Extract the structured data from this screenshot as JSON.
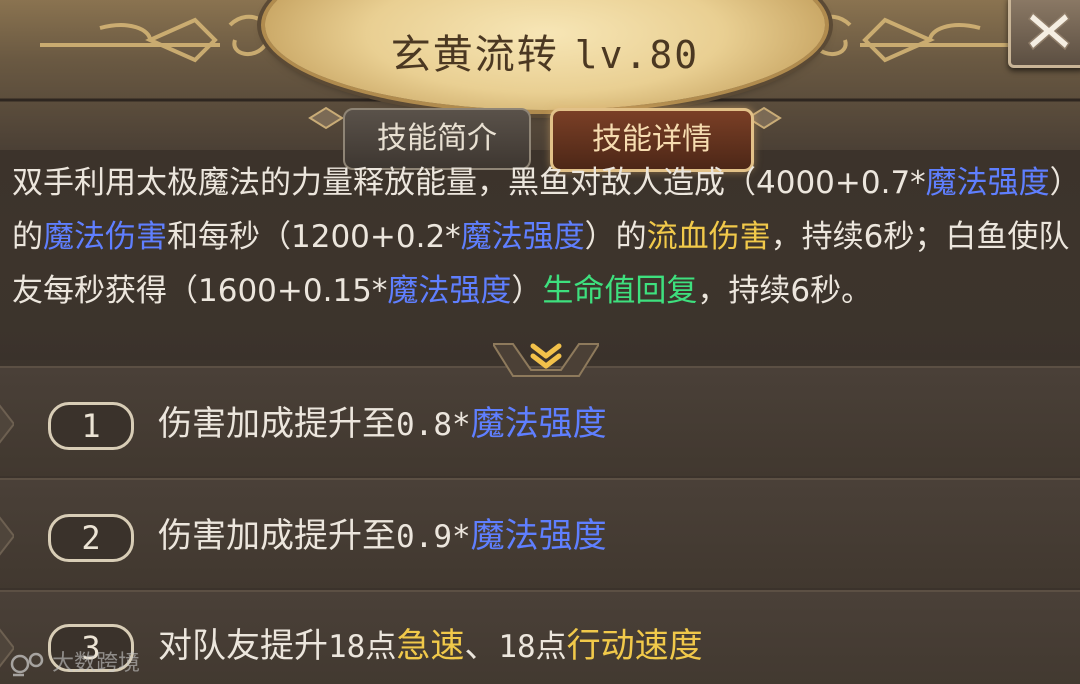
{
  "header": {
    "skill_name": "玄黄流转",
    "skill_level": "lv.80"
  },
  "tabs": [
    {
      "label": "技能简介",
      "active": false
    },
    {
      "label": "技能详情",
      "active": true
    }
  ],
  "description": {
    "segments": [
      {
        "text": "双手利用太极魔法的力量释放能量，黑鱼对敌人造成（4000+0.7*",
        "style": "normal"
      },
      {
        "text": "魔法强度",
        "style": "blue"
      },
      {
        "text": "）的",
        "style": "normal"
      },
      {
        "text": "魔法伤害",
        "style": "blue"
      },
      {
        "text": "和每秒（1200+0.2*",
        "style": "normal"
      },
      {
        "text": "魔法强度",
        "style": "blue"
      },
      {
        "text": "）的",
        "style": "normal"
      },
      {
        "text": "流血伤害",
        "style": "gold"
      },
      {
        "text": "，持续6秒；白鱼使队友每秒获得（1600+0.15*",
        "style": "normal"
      },
      {
        "text": "魔法强度",
        "style": "blue"
      },
      {
        "text": "）",
        "style": "normal"
      },
      {
        "text": "生命值回复",
        "style": "green"
      },
      {
        "text": "，持续6秒。",
        "style": "normal"
      }
    ]
  },
  "upgrades": [
    {
      "number": "1",
      "prefix": "伤害加成提升至",
      "value": "0.8*",
      "highlight": "魔法强度",
      "highlight_color": "blue"
    },
    {
      "number": "2",
      "prefix": "伤害加成提升至",
      "value": "0.9*",
      "highlight": "魔法强度",
      "highlight_color": "blue"
    },
    {
      "number": "3",
      "prefix": "对队友提升",
      "value1": "18点",
      "highlight1": "急速",
      "separator": "、",
      "value2": "18点",
      "highlight2": "行动速度",
      "highlight_color": "gold"
    }
  ],
  "watermark": {
    "text": "大数跨境"
  },
  "colors": {
    "blue_highlight": "#5f7fff",
    "gold_highlight": "#f1c94a",
    "green_highlight": "#3ee07e",
    "title_gold": "#e9cf92",
    "active_tab": "#7a3f26"
  },
  "icons": {
    "close": "close-x-icon",
    "expand": "chevron-double-down-icon",
    "watermark_logo": "dashu-logo-icon"
  }
}
